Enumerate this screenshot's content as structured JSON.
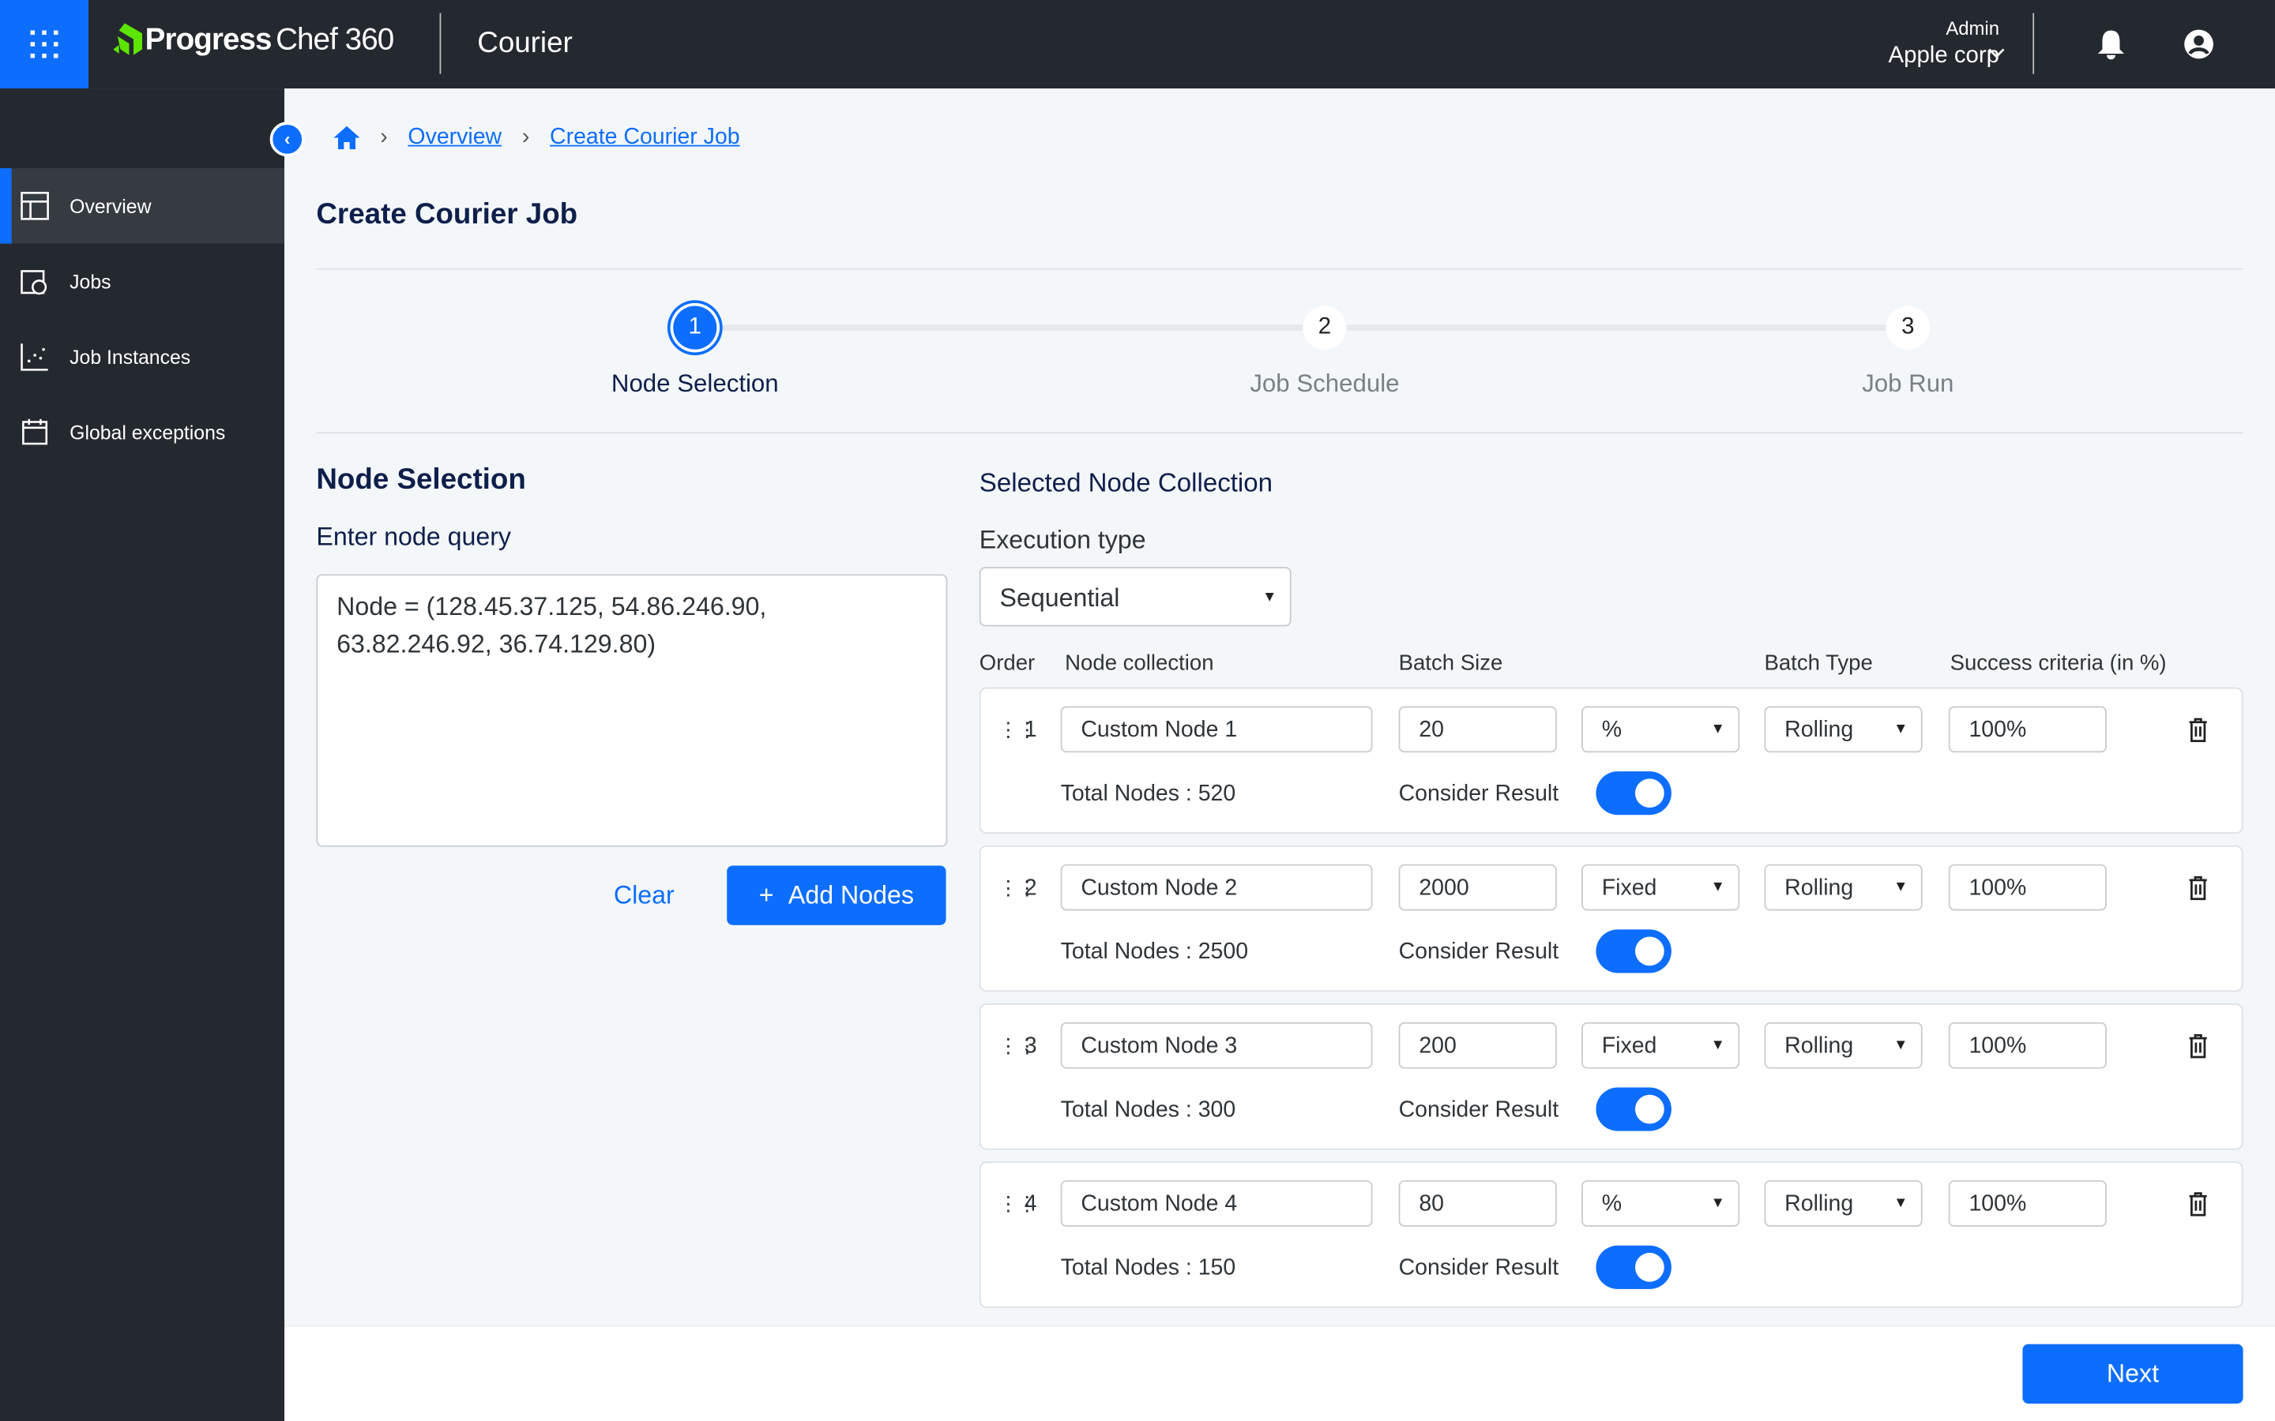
{
  "header": {
    "brand": "Progress",
    "brand_product": "Chef 360",
    "product": "Courier",
    "role": "Admin",
    "org": "Apple corp"
  },
  "sidebar": {
    "items": [
      {
        "label": "Overview",
        "active": true
      },
      {
        "label": "Jobs"
      },
      {
        "label": "Job Instances"
      },
      {
        "label": "Global exceptions"
      }
    ]
  },
  "breadcrumb": [
    "Overview",
    "Create Courier Job"
  ],
  "page_title": "Create Courier Job",
  "steps": [
    {
      "num": "1",
      "label": "Node Selection",
      "active": true
    },
    {
      "num": "2",
      "label": "Job Schedule"
    },
    {
      "num": "3",
      "label": "Job Run"
    }
  ],
  "node_selection": {
    "title": "Node Selection",
    "query_label": "Enter node query",
    "query_value": "Node = (128.45.37.125, 54.86.246.90, 63.82.246.92, 36.74.129.80)",
    "clear": "Clear",
    "add": "Add Nodes"
  },
  "collection": {
    "title": "Selected Node Collection",
    "exec_label": "Execution type",
    "exec_value": "Sequential",
    "headers": [
      "Order",
      "Node collection",
      "Batch Size",
      "Batch Type",
      "Success criteria (in %)"
    ],
    "consider_label": "Consider Result",
    "rows": [
      {
        "order": "1",
        "name": "Custom Node 1",
        "batch": "20",
        "unit": "%",
        "type": "Rolling",
        "success": "100%",
        "total": "Total Nodes : 520",
        "consider": true
      },
      {
        "order": "2",
        "name": "Custom Node 2",
        "batch": "2000",
        "unit": "Fixed",
        "type": "Rolling",
        "success": "100%",
        "total": "Total Nodes : 2500",
        "consider": true
      },
      {
        "order": "3",
        "name": "Custom Node 3",
        "batch": "200",
        "unit": "Fixed",
        "type": "Rolling",
        "success": "100%",
        "total": "Total Nodes : 300",
        "consider": true
      },
      {
        "order": "4",
        "name": "Custom Node 4",
        "batch": "80",
        "unit": "%",
        "type": "Rolling",
        "success": "100%",
        "total": "Total Nodes : 150",
        "consider": true
      }
    ]
  },
  "footer": {
    "next": "Next"
  },
  "colors": {
    "accent": "#0d6efd",
    "topbar": "#24282f",
    "title": "#0f1f4b"
  }
}
